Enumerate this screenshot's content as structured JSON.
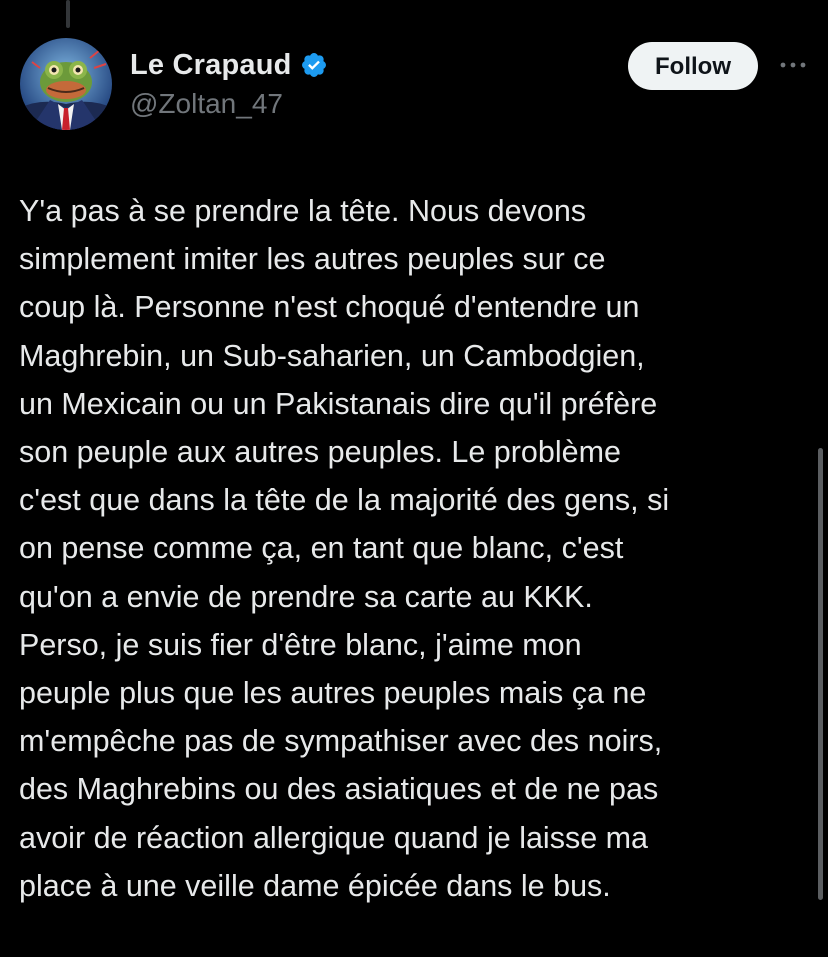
{
  "author": {
    "display_name": "Le Crapaud",
    "handle": "@Zoltan_47",
    "verified": true,
    "avatar_icon": "frog-in-suit-avatar"
  },
  "actions": {
    "follow_label": "Follow",
    "more_icon": "more-horizontal-icon"
  },
  "tweet": {
    "text": "Y'a pas à se prendre la tête. Nous devons\nsimplement imiter les autres peuples sur ce\ncoup là. Personne n'est choqué d'entendre un\nMaghrebin, un Sub-saharien, un Cambodgien,\nun Mexicain ou un Pakistanais dire qu'il préfère\nson peuple aux autres peuples. Le problème\nc'est que dans la tête de la majorité des gens, si\non pense comme ça, en tant que blanc, c'est\nqu'on a envie de prendre sa carte au KKK.\nPerso, je suis fier d'être blanc, j'aime mon\npeuple plus que les autres peuples mais ça ne\nm'empêche pas de sympathiser avec des noirs,\ndes Maghrebins ou des asiatiques et de ne pas\navoir de réaction allergique quand je laisse ma\nplace à une veille dame épicée dans le bus."
  },
  "colors": {
    "background": "#000000",
    "text_primary": "#e7e9ea",
    "text_secondary": "#71767b",
    "verified_blue": "#1d9bf0",
    "follow_bg": "#eff3f4"
  }
}
